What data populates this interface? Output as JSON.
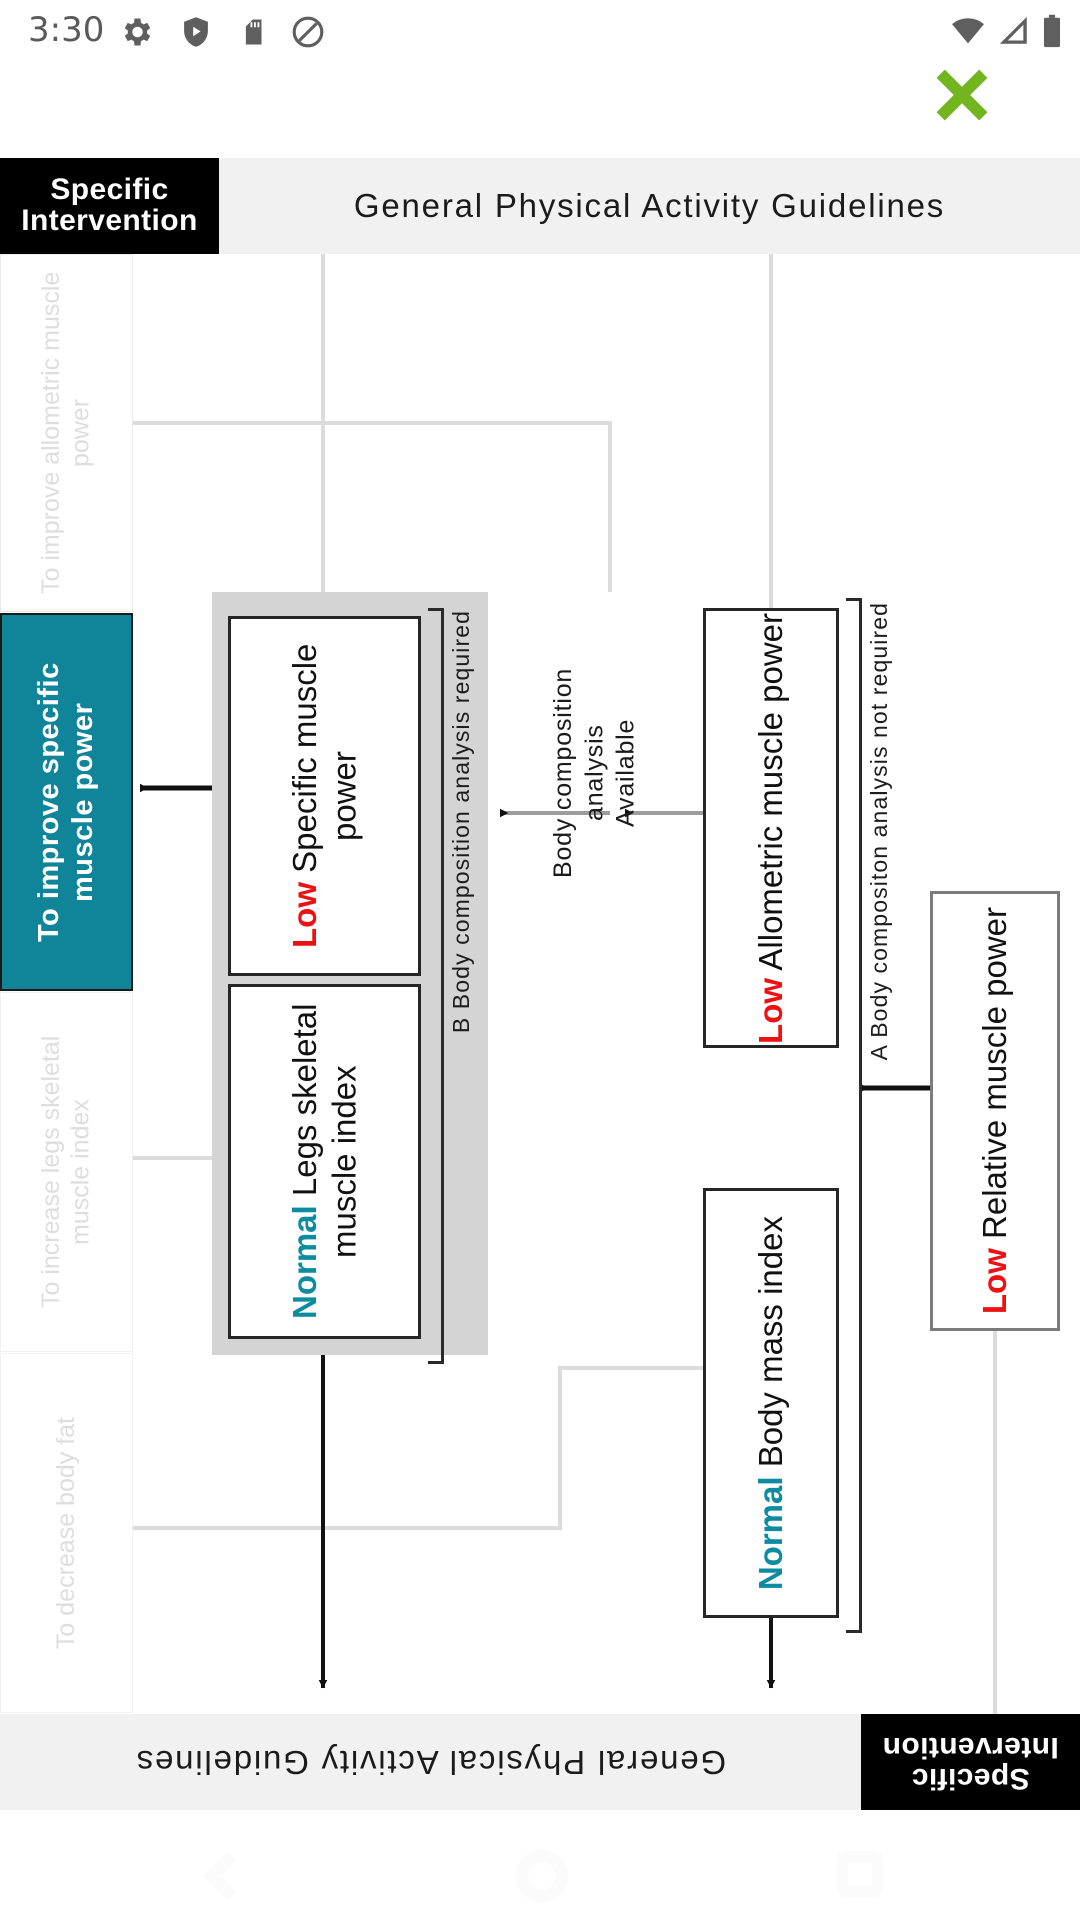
{
  "statusbar": {
    "time": "3:30",
    "left_icons": [
      "gear-icon",
      "play-protect-icon",
      "sd-card-icon",
      "do-not-disturb-icon"
    ],
    "right_icons": [
      "wifi-icon",
      "signal-icon",
      "battery-icon"
    ]
  },
  "notification": {
    "icon": "green-close-x-icon",
    "color": "#72b51e"
  },
  "diagram": {
    "header": {
      "left_label": "Specific Intervention",
      "left_label_line1": "Specific",
      "left_label_line2": "Intervention",
      "title": "General Physical  Activity  Guidelines"
    },
    "footer": {
      "left_label_line1": "Specific",
      "left_label_line2": "Intervention",
      "title": "General Physical  Activity  Guidelines"
    },
    "interventions": [
      {
        "id": "improve-allometric",
        "label": "To improve allometric muscle power",
        "active": false
      },
      {
        "id": "improve-specific",
        "label": "To improve specific muscle power",
        "active": true,
        "color": "#10859a"
      },
      {
        "id": "increase-legs-smi",
        "label": "To increase legs skeletal muscle index",
        "active": false
      },
      {
        "id": "decrease-body-fat",
        "label": "To decrease body fat",
        "active": false
      }
    ],
    "nodes": [
      {
        "id": "low-specific-muscle-power",
        "keyword": "Low",
        "keyword_color": "#ee1111",
        "rest": " Specific muscle power"
      },
      {
        "id": "normal-legs-smi",
        "keyword": "Normal",
        "keyword_color": "#0d8ba1",
        "rest": " Legs skeletal muscle index"
      },
      {
        "id": "low-allometric-muscle-power",
        "keyword": "Low",
        "keyword_color": "#ee1111",
        "rest": " Allometric muscle power"
      },
      {
        "id": "normal-body-mass-index",
        "keyword": "Normal",
        "keyword_color": "#0d8ba1",
        "rest": " Body mass index"
      },
      {
        "id": "low-relative-muscle-power",
        "keyword": "Low",
        "keyword_color": "#ee1111",
        "rest": " Relative muscle power"
      }
    ],
    "brackets": [
      {
        "id": "bracket-a",
        "letter": "A",
        "label": "A  Body compositon analysis not required"
      },
      {
        "id": "bracket-b",
        "letter": "B",
        "label": "B  Body composition analysis required"
      }
    ],
    "edge_labels": [
      {
        "id": "body-composition-available",
        "line1": "Body composition analysis",
        "line2": "Available"
      }
    ]
  },
  "navbar": {
    "items": [
      "back-button",
      "home-button",
      "recents-button"
    ]
  }
}
